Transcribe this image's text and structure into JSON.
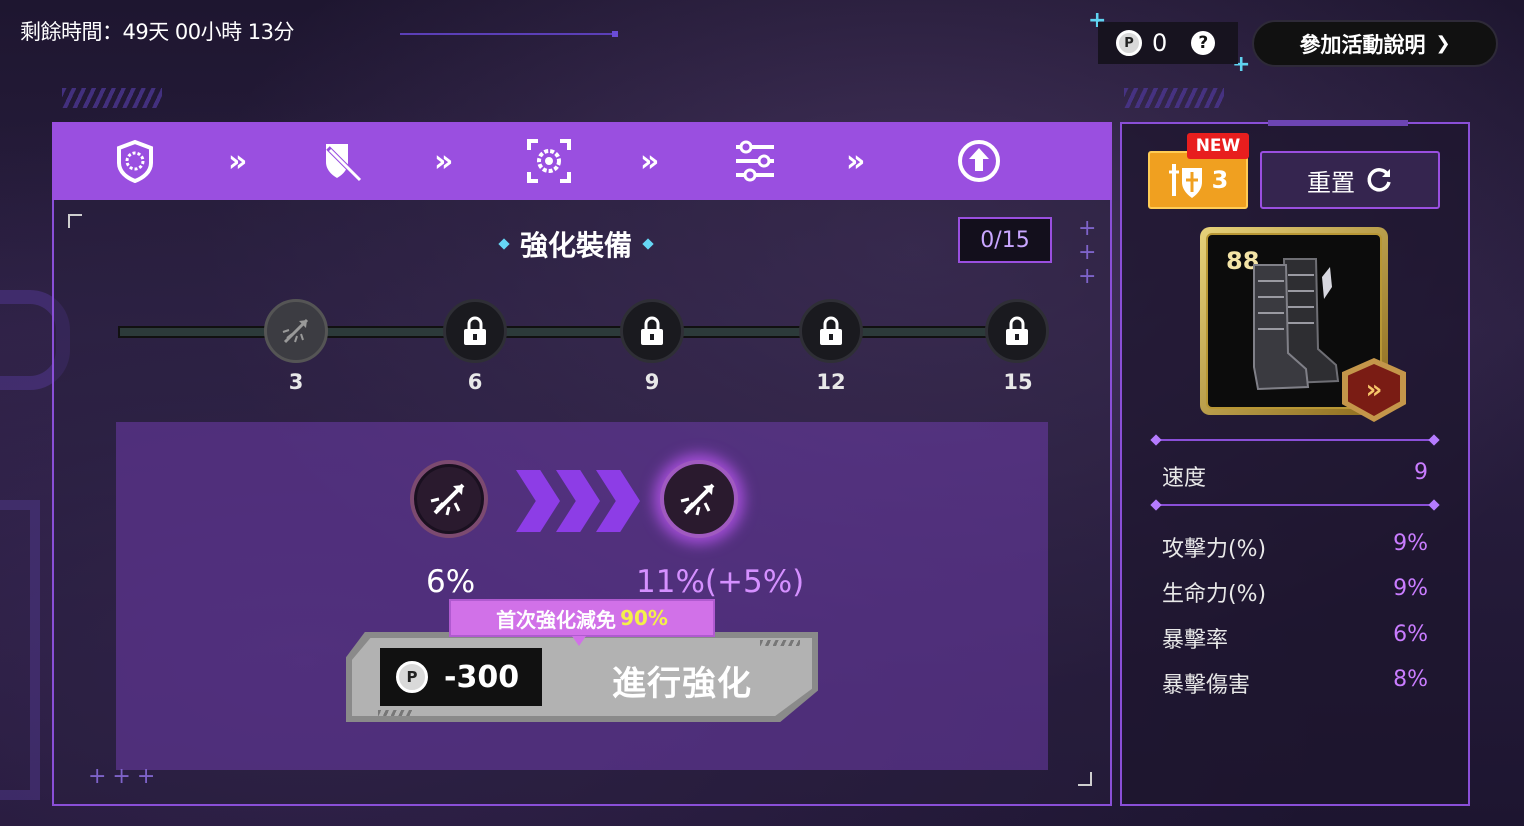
{
  "top": {
    "timer": "剩餘時間：49天 00小時 13分",
    "coin_value": "0",
    "coin_symbol": "P",
    "help_symbol": "?",
    "join_button": "參加活動說明",
    "join_chevron": "❯"
  },
  "steps": {
    "icons": [
      "shield-badge-icon",
      "shield-sword-icon",
      "focus-gear-icon",
      "sliders-icon",
      "upgrade-arrow-icon"
    ],
    "separator": "»"
  },
  "main": {
    "title": "強化裝備",
    "progress": "0/15",
    "milestones": [
      "3",
      "6",
      "9",
      "12",
      "15"
    ],
    "current_value": "6%",
    "next_value": "11%(+5%)",
    "discount_label": "首次強化減免",
    "discount_value": "90%",
    "cost": "-300",
    "cost_symbol": "P",
    "enhance_button": "進行強化",
    "accent_color": "#9a4fe0"
  },
  "right": {
    "new_badge": "NEW",
    "boost_count": "3",
    "reset_button": "重置",
    "item_level": "88",
    "item_icon": "boots-icon",
    "item_grade_symbol": "»",
    "primary_stat": {
      "name": "速度",
      "value": "9"
    },
    "stats": [
      {
        "name": "攻擊力(%)",
        "value": "9%"
      },
      {
        "name": "生命力(%)",
        "value": "9%"
      },
      {
        "name": "暴擊率",
        "value": "6%"
      },
      {
        "name": "暴擊傷害",
        "value": "8%"
      }
    ]
  }
}
